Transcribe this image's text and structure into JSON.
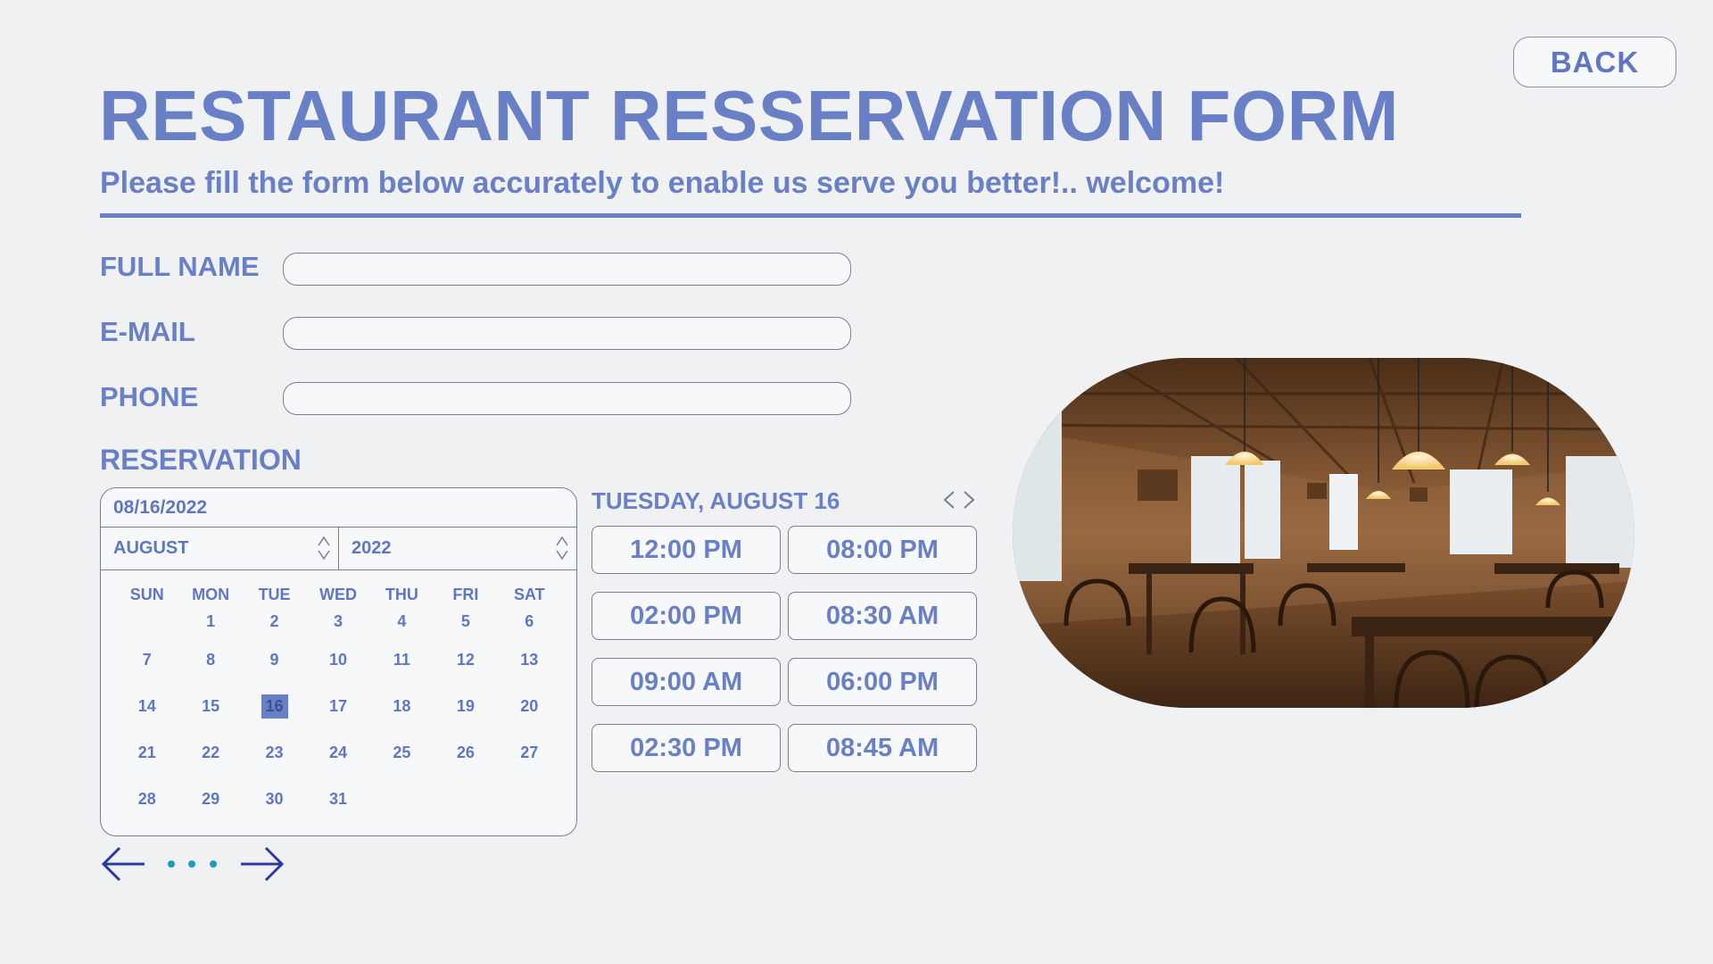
{
  "header": {
    "back_label": "BACK",
    "title": "RESTAURANT RESSERVATION FORM",
    "subtitle": "Please fill the form below accurately to enable us serve you better!.. welcome!"
  },
  "form": {
    "full_name_label": "FULL NAME",
    "full_name_value": "",
    "email_label": "E-MAIL",
    "email_value": "",
    "phone_label": "PHONE",
    "phone_value": "",
    "reservation_label": "RESERVATION"
  },
  "calendar": {
    "date_value": "08/16/2022",
    "month": "AUGUST",
    "year": "2022",
    "weekdays": [
      "SUN",
      "MON",
      "TUE",
      "WED",
      "THU",
      "FRI",
      "SAT"
    ],
    "days": [
      "",
      "1",
      "2",
      "3",
      "4",
      "5",
      "6",
      "7",
      "8",
      "9",
      "10",
      "11",
      "12",
      "13",
      "14",
      "15",
      "16",
      "17",
      "18",
      "19",
      "20",
      "21",
      "22",
      "23",
      "24",
      "25",
      "26",
      "27",
      "28",
      "29",
      "30",
      "31",
      "",
      "",
      ""
    ],
    "selected_day": "16"
  },
  "times": {
    "heading": "TUESDAY, AUGUST 16",
    "slots": [
      "12:00 PM",
      "08:00 PM",
      "02:00 PM",
      "08:30 AM",
      "09:00 AM",
      "06:00 PM",
      "02:30 PM",
      "08:45 AM"
    ]
  },
  "colors": {
    "accent": "#6a80c6",
    "background": "#f0f1f3",
    "pager_arrows": "#2d3aa5",
    "pager_dots": "#1e9cc0"
  },
  "icons": {
    "day_nav": "chevron-left-right-icon",
    "pager_prev": "arrow-left-icon",
    "pager_next": "arrow-right-icon",
    "pager_dots": "ellipsis-icon",
    "stepper": "up-down-stepper-icon"
  }
}
